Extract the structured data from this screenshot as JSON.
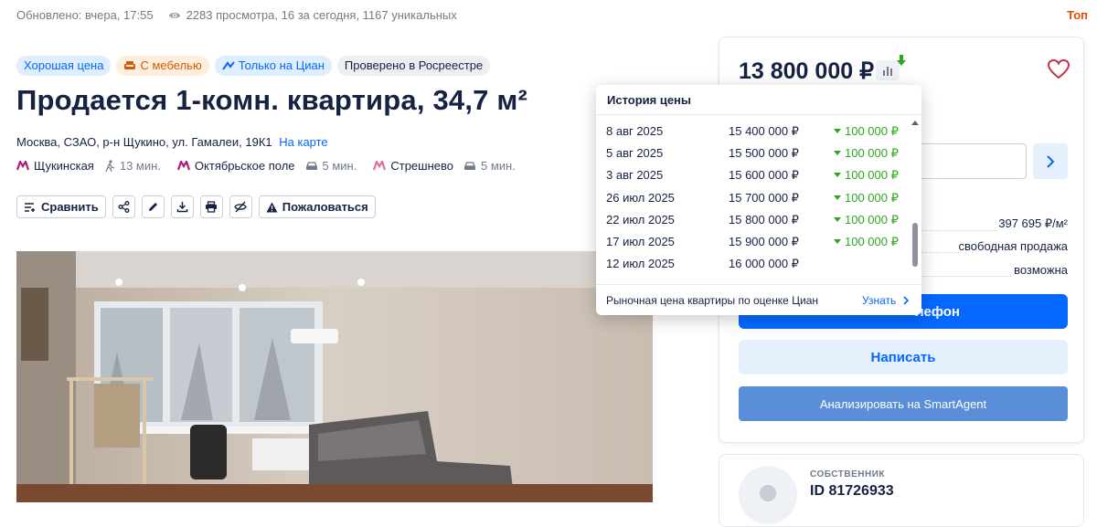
{
  "topbar": {
    "updated": "Обновлено: вчера, 17:55",
    "views": "2283 просмотра, 16 за сегодня, 1167 уникальных",
    "right_label": "Топ"
  },
  "tags": [
    {
      "label": "Хорошая цена",
      "style": "blue"
    },
    {
      "label": "С мебелью",
      "style": "orange"
    },
    {
      "label": "Только на Циан",
      "style": "blue"
    },
    {
      "label": "Проверено в Росреестре",
      "style": "gray"
    }
  ],
  "title": "Продается 1-комн. квартира, 34,7 м²",
  "address": {
    "text": "Москва, СЗАО, р-н Щукино, ул. Гамалеи, 19К1",
    "map_link": "На карте"
  },
  "metro": [
    {
      "name": "Щукинская",
      "time": "13 мин.",
      "mode": "walk",
      "color": "#b21e7a"
    },
    {
      "name": "Октябрьское поле",
      "time": "5 мин.",
      "mode": "car",
      "color": "#b21e7a"
    },
    {
      "name": "Стрешнево",
      "time": "5 мин.",
      "mode": "car",
      "color": "#e66aa2"
    }
  ],
  "actions": {
    "compare": "Сравнить",
    "complain": "Пожаловаться"
  },
  "sidebar": {
    "price": "13 800 000 ₽",
    "price_per_m2": "397 695 ₽/м²",
    "sale_type": "свободная продажа",
    "mortgage": "возможна",
    "phone_button": "лефон",
    "write_button": "Написать",
    "smart_button": "Анализировать на SmartAgent",
    "owner_label": "СОБСТВЕННИК",
    "owner_id": "ID 81726933"
  },
  "price_history": {
    "title": "История цены",
    "rows": [
      {
        "date": "8 авг 2025",
        "price": "15 400 000 ₽",
        "change": "100 000 ₽"
      },
      {
        "date": "5 авг 2025",
        "price": "15 500 000 ₽",
        "change": "100 000 ₽"
      },
      {
        "date": "3 авг 2025",
        "price": "15 600 000 ₽",
        "change": "100 000 ₽"
      },
      {
        "date": "26 июл 2025",
        "price": "15 700 000 ₽",
        "change": "100 000 ₽"
      },
      {
        "date": "22 июл 2025",
        "price": "15 800 000 ₽",
        "change": "100 000 ₽"
      },
      {
        "date": "17 июл 2025",
        "price": "15 900 000 ₽",
        "change": "100 000 ₽"
      },
      {
        "date": "12 июл 2025",
        "price": "16 000 000 ₽",
        "change": ""
      }
    ],
    "footer": "Рыночная цена квартиры по оценке Циан",
    "footer_link": "Узнать"
  },
  "colors": {
    "accent": "#0468ff",
    "down_green": "#2fa520",
    "price_down_arrow": "#2fa520"
  }
}
